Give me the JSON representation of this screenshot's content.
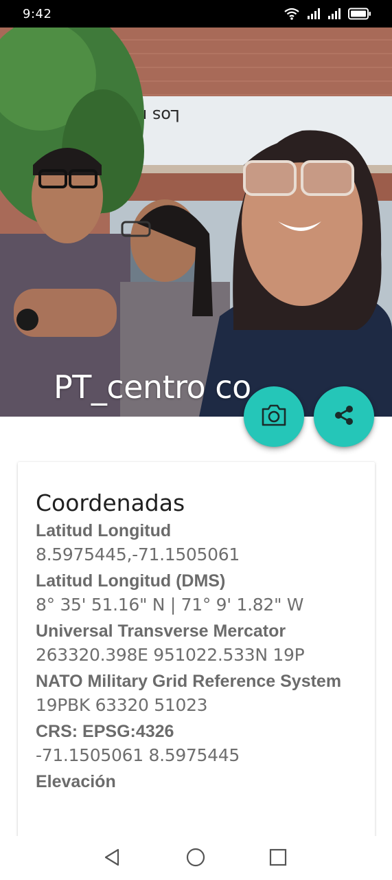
{
  "status_bar": {
    "time": "9:42",
    "icons": [
      "wifi-icon",
      "signal-icon",
      "signal-icon",
      "battery-icon"
    ]
  },
  "header": {
    "title": "PT_centro co...",
    "photo_icon": "group-selfie-photo"
  },
  "actions": {
    "camera_icon": "camera-icon",
    "share_icon": "share-icon",
    "accent_color": "#25c6b8"
  },
  "card": {
    "title": "Coordenadas",
    "items": [
      {
        "label": "Latitud Longitud",
        "value": "8.5975445,-71.1505061"
      },
      {
        "label": "Latitud Longitud (DMS)",
        "value": "8° 35' 51.16\" N | 71° 9' 1.82\" W"
      },
      {
        "label": "Universal Transverse Mercator",
        "value": "263320.398E 951022.533N 19P"
      },
      {
        "label": "NATO Military Grid Reference System",
        "value": "19PBK 63320 51023"
      },
      {
        "label": "CRS: EPSG:4326",
        "value": "-71.1505061 8.5975445"
      },
      {
        "label": "Elevación",
        "value": ""
      }
    ]
  },
  "nav": {
    "icons": [
      "back-icon",
      "home-icon",
      "recents-icon"
    ]
  }
}
